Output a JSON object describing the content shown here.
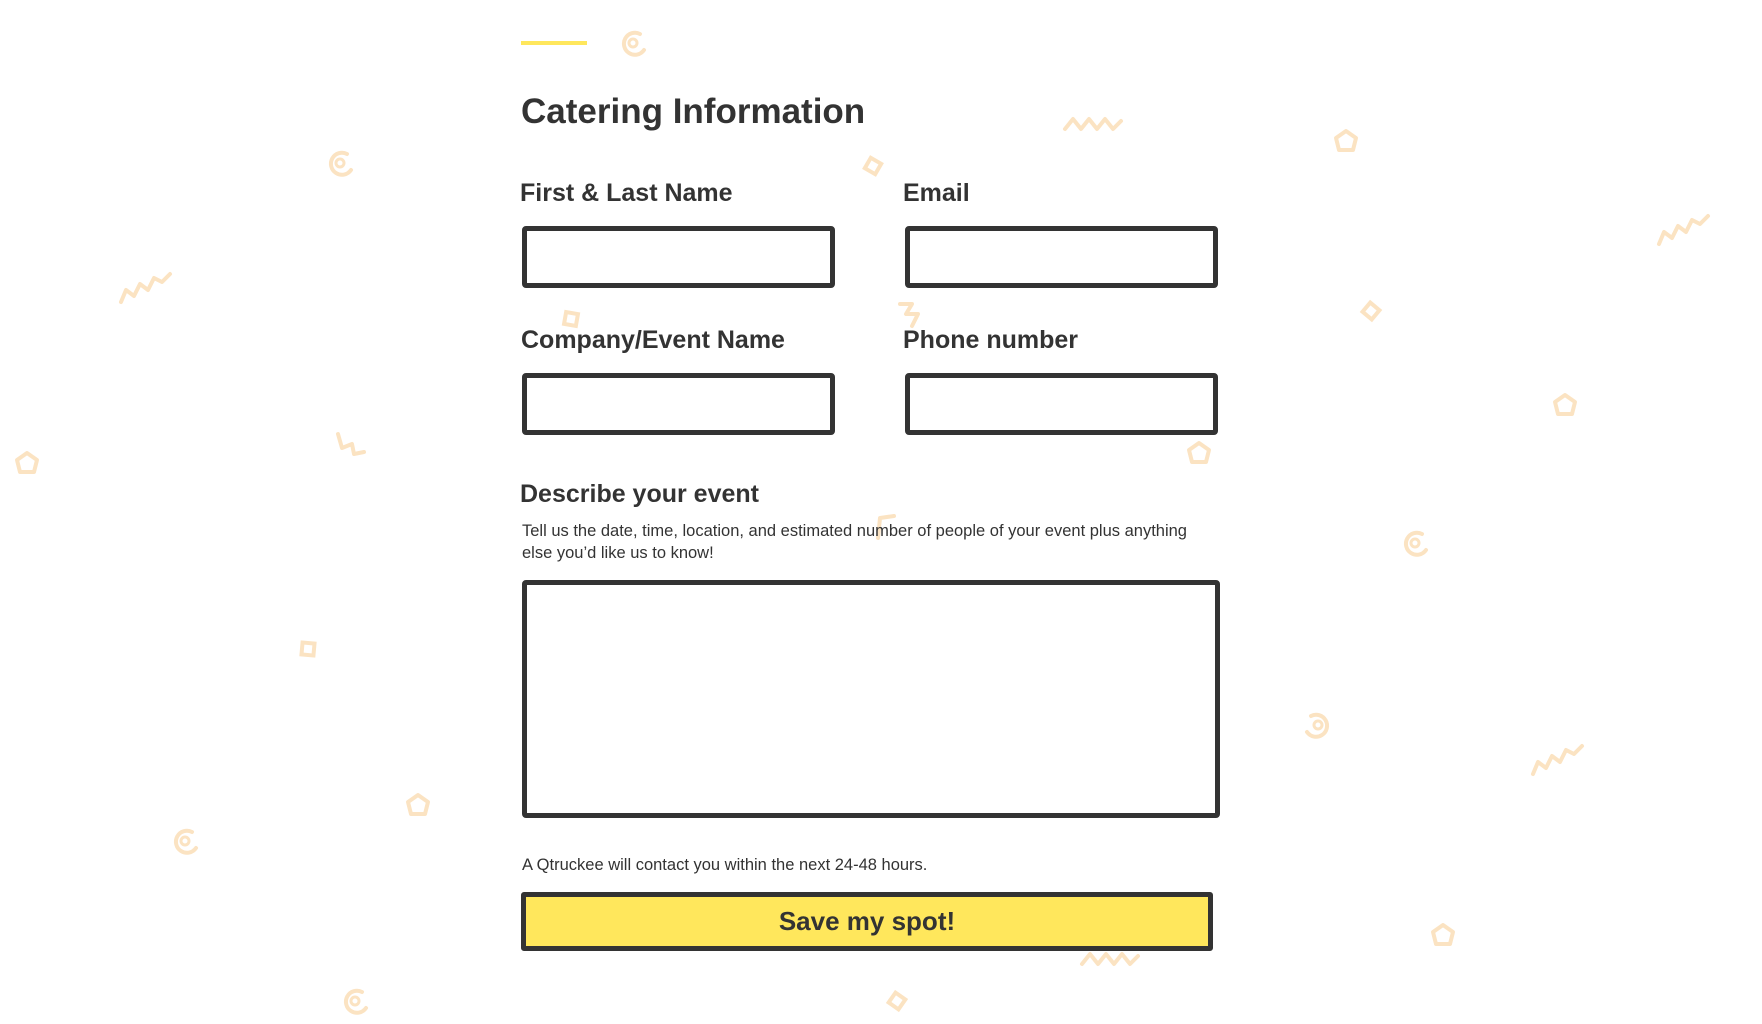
{
  "form": {
    "title": "Catering Information",
    "fields": {
      "name": {
        "label": "First & Last Name",
        "value": ""
      },
      "email": {
        "label": "Email",
        "value": ""
      },
      "company": {
        "label": "Company/Event Name",
        "value": ""
      },
      "phone": {
        "label": "Phone number",
        "value": ""
      },
      "event": {
        "label": "Describe your event",
        "helper": "Tell us the date, time, location, and estimated number of people of your event plus anything else you’d like us to know!",
        "value": ""
      }
    },
    "contact_note": "A Qtruckee will contact you within the next 24-48 hours.",
    "submit_label": "Save my spot!"
  },
  "colors": {
    "accent": "#ffe75c",
    "text": "#333333",
    "border": "#333333",
    "confetti": "#fbe3c2"
  },
  "decorations": [
    "spiral-icon",
    "zigzag-icon",
    "pentagon-icon"
  ]
}
